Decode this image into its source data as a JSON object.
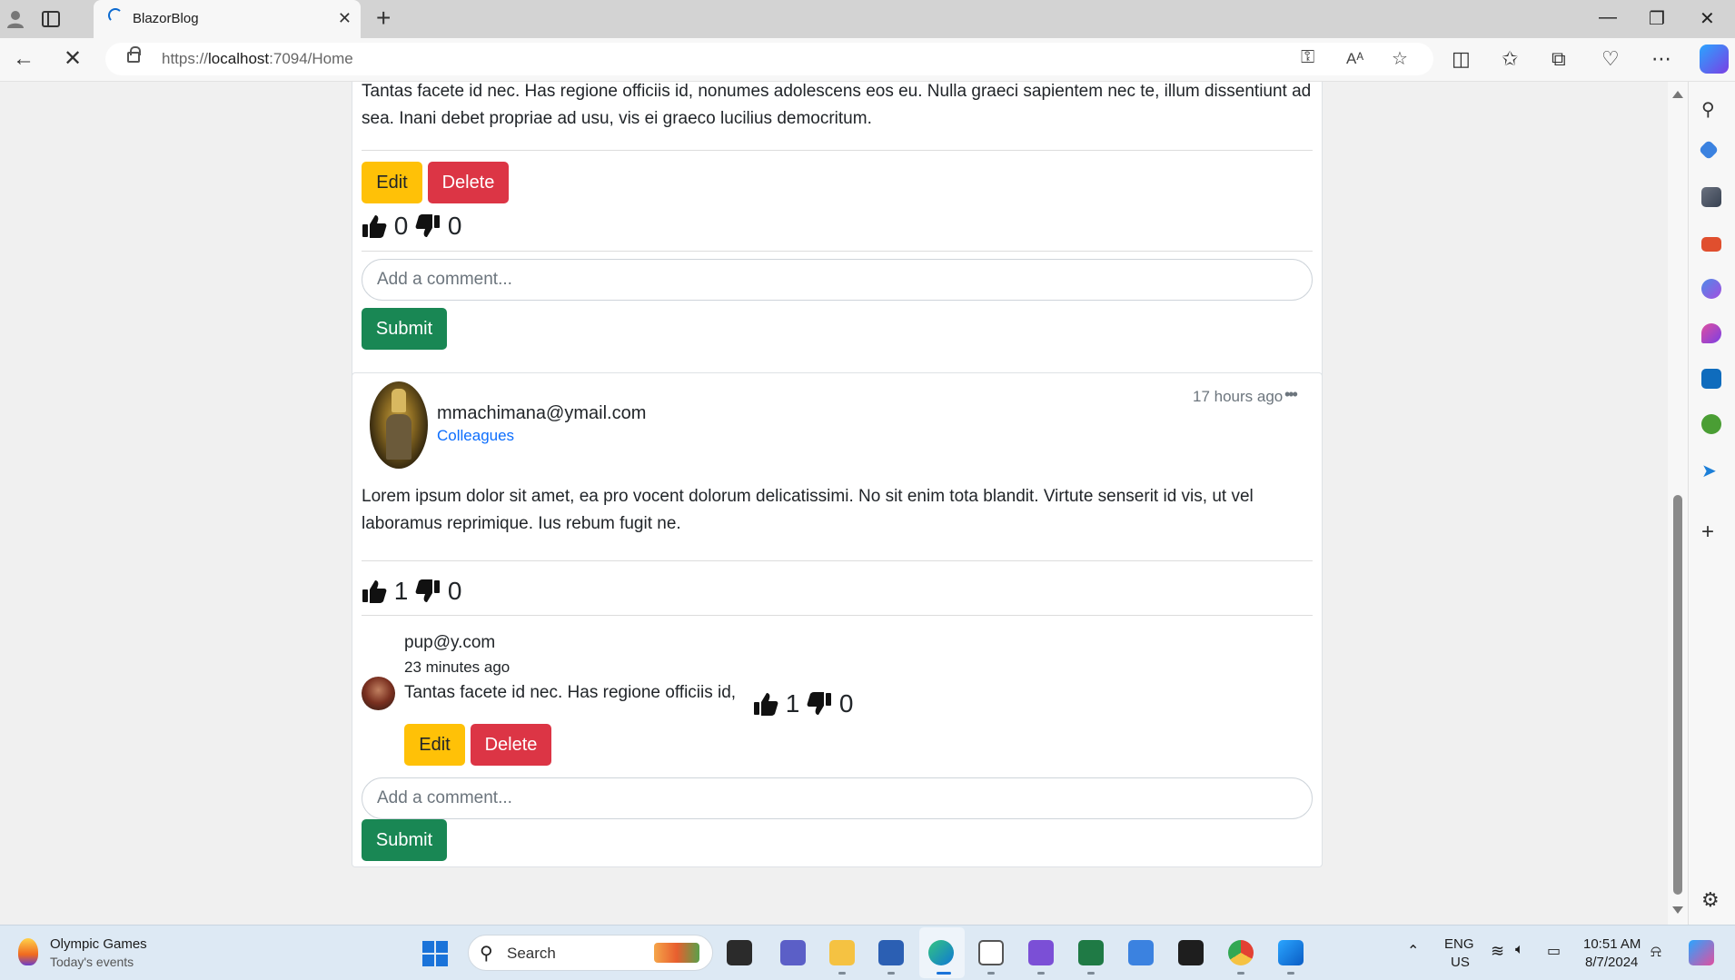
{
  "browser": {
    "tab_title": "BlazorBlog",
    "url_prefix": "https://",
    "url_host": "localhost",
    "url_rest": ":7094/Home"
  },
  "post1": {
    "text": "Tantas facete id nec. Has regione officiis id, nonumes adolescens eos eu. Nulla graeci sapientem nec te, illum dissentiunt ad sea. Inani debet propriae ad usu, vis ei graeco lucilius democritum.",
    "edit_label": "Edit",
    "delete_label": "Delete",
    "likes": "0",
    "dislikes": "0",
    "comment_placeholder": "Add a comment...",
    "submit_label": "Submit"
  },
  "post2": {
    "author": "mmachimana@ymail.com",
    "audience": "Colleagues",
    "time": "17 hours ago",
    "menu": "•••",
    "text": "Lorem ipsum dolor sit amet, ea pro vocent dolorum delicatissimi. No sit enim tota blandit. Virtute senserit id vis, ut vel laboramus reprimique. Ius rebum fugit ne.",
    "likes": "1",
    "dislikes": "0",
    "comment": {
      "author": "pup@y.com",
      "time": "23 minutes ago",
      "text": "Tantas facete id nec. Has regione officiis id,",
      "likes": "1",
      "dislikes": "0",
      "edit_label": "Edit",
      "delete_label": "Delete"
    },
    "comment_placeholder": "Add a comment...",
    "submit_label": "Submit"
  },
  "taskbar": {
    "news_title": "Olympic Games",
    "news_sub": "Today's events",
    "search_label": "Search",
    "lang_1": "ENG",
    "lang_2": "US",
    "time": "10:51 AM",
    "date": "8/7/2024"
  },
  "colors": {
    "edit": "#ffc107",
    "delete": "#dc3545",
    "submit": "#198754",
    "link": "#0d6efd"
  }
}
